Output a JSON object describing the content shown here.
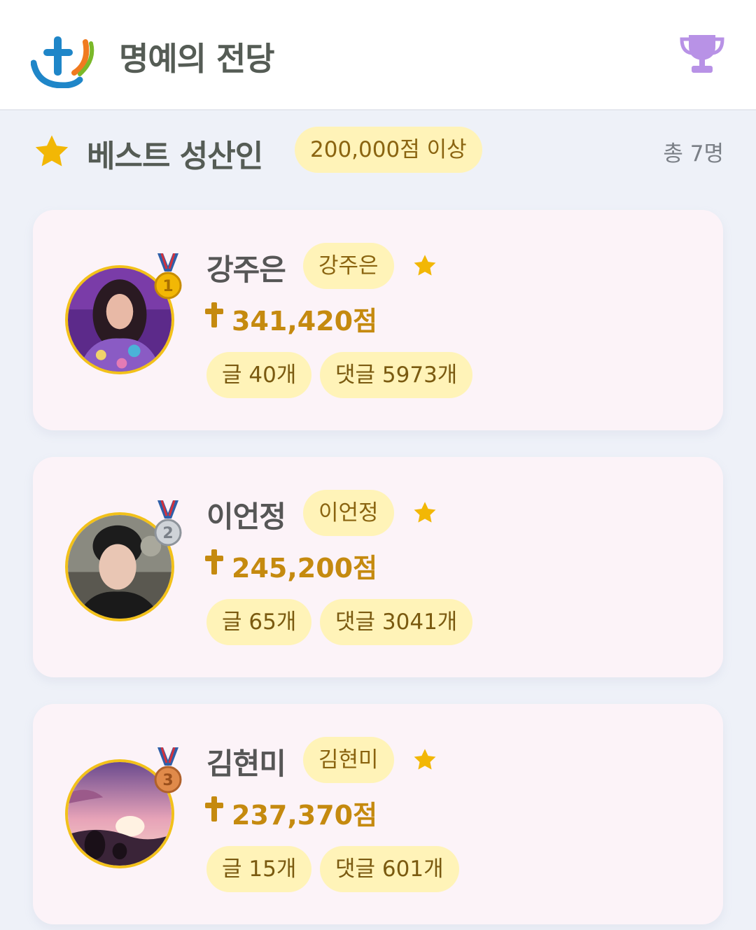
{
  "header": {
    "title": "명예의 전당",
    "logo_icon": "cross-logo-icon",
    "trophy_icon": "trophy-icon",
    "trophy_color": "#b892e6"
  },
  "section": {
    "title": "베스트 성산인",
    "star_icon": "star-icon",
    "threshold": "200,000점 이상",
    "total": "총 7명"
  },
  "members": [
    {
      "rank": 1,
      "medal": "gold-medal-icon",
      "name": "강주은",
      "nickname": "강주은",
      "score": "341,420점",
      "posts": "글 40개",
      "comments": "댓글 5973개"
    },
    {
      "rank": 2,
      "medal": "silver-medal-icon",
      "name": "이언정",
      "nickname": "이언정",
      "score": "245,200점",
      "posts": "글 65개",
      "comments": "댓글 3041개"
    },
    {
      "rank": 3,
      "medal": "bronze-medal-icon",
      "name": "김현미",
      "nickname": "김현미",
      "score": "237,370점",
      "posts": "글 15개",
      "comments": "댓글 601개"
    }
  ],
  "colors": {
    "accent_yellow": "#f2c11a",
    "pill_background": "#fff3b8",
    "score_gold": "#c58a0f",
    "card_background": "#fcf3f8"
  }
}
